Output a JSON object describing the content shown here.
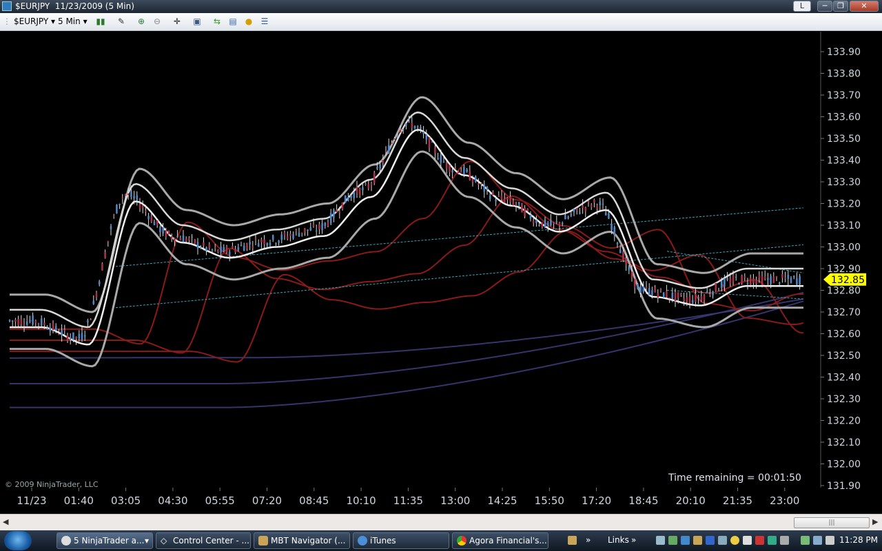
{
  "window": {
    "title": "$EURJPY  11/23/2009 (5 Min)",
    "buttons": {
      "layout": "L",
      "minimize": "─",
      "maximize": "❐",
      "close": "✕"
    }
  },
  "toolbar": {
    "instrument": "$EURJPY",
    "interval": "5 Min",
    "icons": [
      "bar-style-icon",
      "drawing-tool-icon",
      "zoom-in-icon",
      "zoom-out-icon",
      "crosshair-icon",
      "data-box-icon",
      "strategy-icon",
      "indicators-icon",
      "order-icon",
      "properties-icon"
    ]
  },
  "chart": {
    "copyright": "© 2009 NinjaTrader, LLC",
    "time_remaining": "Time remaining = 00:01:50",
    "last_price": "132.85",
    "price_axis_labels": [
      "133.90",
      "133.80",
      "133.70",
      "133.60",
      "133.50",
      "133.40",
      "133.30",
      "133.20",
      "133.10",
      "133.00",
      "132.90",
      "132.80",
      "132.70",
      "132.60",
      "132.50",
      "132.40",
      "132.30",
      "132.20",
      "132.10",
      "132.00",
      "131.90"
    ],
    "time_axis_labels": [
      "11/23",
      "01:40",
      "03:05",
      "04:30",
      "05:55",
      "07:20",
      "08:45",
      "10:10",
      "11:35",
      "13:00",
      "14:25",
      "15:50",
      "17:20",
      "18:45",
      "20:10",
      "21:35",
      "23:00"
    ],
    "colors": {
      "background": "#000000",
      "up_candle": "#4f86c6",
      "down_candle": "#a8324a",
      "outer_band": "#a9a9a9",
      "inner_band": "#d8d8d8",
      "slow_ma": "#8b1a1a",
      "long_ma": "#3b3b7a",
      "trendline": "#3aa7b8",
      "price_marker": "#ffff00"
    }
  },
  "chart_data": {
    "type": "line",
    "title": "$EURJPY  11/23/2009 (5 Min)",
    "ylim": [
      131.88,
      133.94
    ],
    "x": [
      "11/23",
      "01:40",
      "03:05",
      "04:30",
      "05:55",
      "07:20",
      "08:45",
      "10:10",
      "11:35",
      "13:00",
      "14:25",
      "15:50",
      "17:20",
      "18:45",
      "20:10",
      "21:35",
      "23:00"
    ],
    "series": [
      {
        "values": [
          132.66,
          132.58,
          133.24,
          133.05,
          132.98,
          133.03,
          133.08,
          133.26,
          133.57,
          133.36,
          133.22,
          133.1,
          133.2,
          132.8,
          132.76,
          132.85,
          132.85
        ]
      }
    ]
  },
  "taskbar": {
    "tasks": [
      {
        "label": "5 NinjaTrader a..."
      },
      {
        "label": "Control Center - ..."
      },
      {
        "label": "MBT Navigator (..."
      },
      {
        "label": "iTunes"
      },
      {
        "label": "Agora Financial's..."
      }
    ],
    "links": "Links",
    "clock": "11:28 PM"
  }
}
